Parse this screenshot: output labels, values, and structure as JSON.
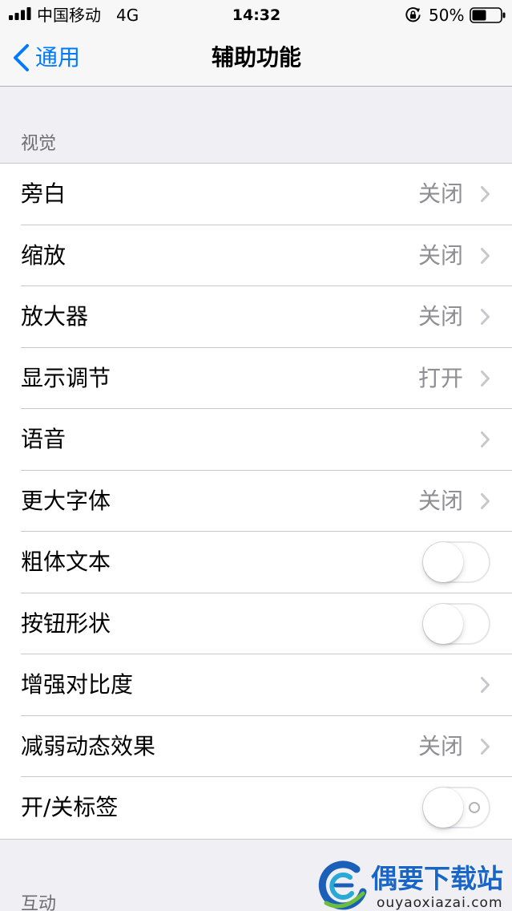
{
  "status_bar": {
    "signal_icon": "signal-bars-icon",
    "signal_bars": 4,
    "carrier": "中国移动",
    "network": "4G",
    "time": "14:32",
    "rotation_lock_icon": "rotation-lock-icon",
    "battery_text": "50%",
    "battery_icon": "battery-icon",
    "battery_level": 0.5
  },
  "nav": {
    "back_icon": "chevron-left-icon",
    "back_label": "通用",
    "title": "辅助功能"
  },
  "sections": [
    {
      "header": "视觉",
      "rows": [
        {
          "label": "旁白",
          "value": "关闭",
          "accessory_icon": "chevron-right-icon"
        },
        {
          "label": "缩放",
          "value": "关闭",
          "accessory_icon": "chevron-right-icon"
        },
        {
          "label": "放大器",
          "value": "关闭",
          "accessory_icon": "chevron-right-icon"
        },
        {
          "label": "显示调节",
          "value": "打开",
          "accessory_icon": "chevron-right-icon"
        },
        {
          "label": "语音",
          "accessory_icon": "chevron-right-icon"
        },
        {
          "label": "更大字体",
          "value": "关闭",
          "accessory_icon": "chevron-right-icon"
        },
        {
          "label": "粗体文本",
          "toggle_on": false
        },
        {
          "label": "按钮形状",
          "toggle_on": false
        },
        {
          "label": "增强对比度",
          "accessory_icon": "chevron-right-icon"
        },
        {
          "label": "减弱动态效果",
          "value": "关闭",
          "accessory_icon": "chevron-right-icon"
        },
        {
          "label": "开/关标签",
          "toggle_on": false,
          "off_label_icon": "off-label-circle-icon"
        }
      ]
    },
    {
      "header": "互动"
    }
  ],
  "watermark": {
    "logo_icon": "ouyao-logo-icon",
    "name": "偶要下载站",
    "domain": "ouyaoxiazai.com"
  },
  "colors": {
    "accent": "#007aff",
    "bar_background": "#f7f7f7",
    "bar_border": "#b2b2b2",
    "grouped_background": "#efeff4",
    "section_header": "#6d6d72",
    "separator": "#c8c7cc",
    "secondary_text": "#8e8e93",
    "chevron": "#c7c7cc",
    "toggle_off_border": "#e5e5ea",
    "toggle_on": "#4cd964",
    "watermark_blue": "#1a66c8"
  }
}
